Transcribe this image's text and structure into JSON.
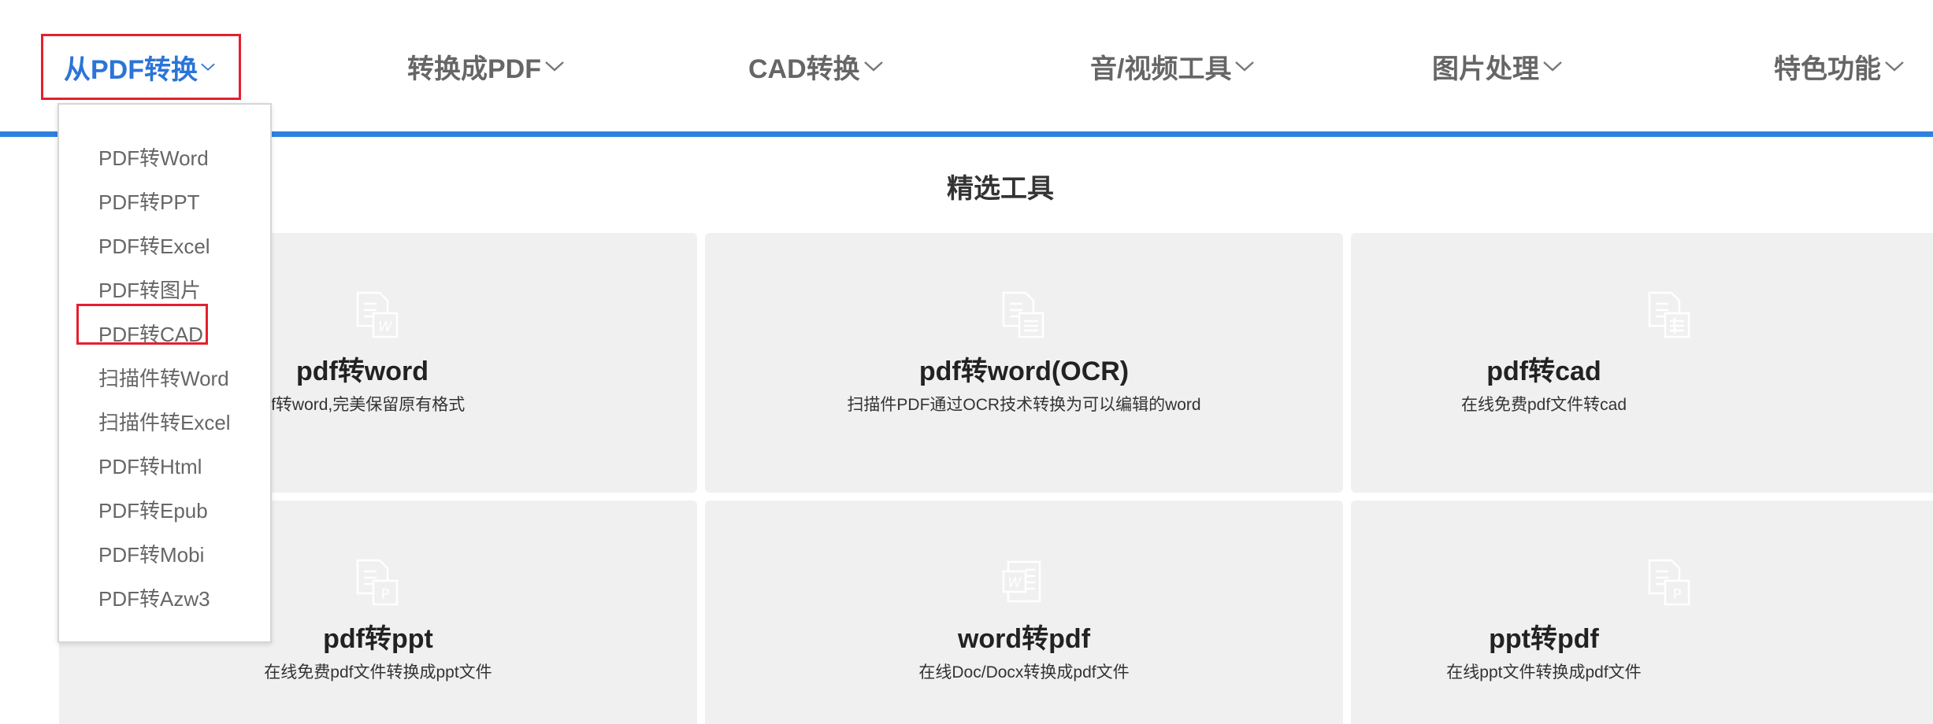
{
  "nav": {
    "items": [
      {
        "label": "从PDF转换",
        "active": true
      },
      {
        "label": "转换成PDF",
        "active": false
      },
      {
        "label": "CAD转换",
        "active": false
      },
      {
        "label": "音/视频工具",
        "active": false
      },
      {
        "label": "图片处理",
        "active": false
      },
      {
        "label": "特色功能",
        "active": false
      }
    ]
  },
  "section_title": "精选工具",
  "cards": [
    {
      "title": "pdf转word",
      "desc": "费pdf转word,完美保留原有格式",
      "icon": "pdf-to-word-icon"
    },
    {
      "title": "pdf转word(OCR)",
      "desc": "扫描件PDF通过OCR技术转换为可以编辑的word",
      "icon": "pdf-ocr-icon"
    },
    {
      "title": "pdf转cad",
      "desc": "在线免费pdf文件转cad",
      "icon": "pdf-to-cad-icon"
    },
    {
      "title": "pdf转ppt",
      "desc": "在线免费pdf文件转换成ppt文件",
      "icon": "pdf-to-ppt-icon"
    },
    {
      "title": "word转pdf",
      "desc": "在线Doc/Docx转换成pdf文件",
      "icon": "word-to-pdf-icon"
    },
    {
      "title": "ppt转pdf",
      "desc": "在线ppt文件转换成pdf文件",
      "icon": "ppt-to-pdf-icon"
    }
  ],
  "dropdown": {
    "items": [
      "PDF转Word",
      "PDF转PPT",
      "PDF转Excel",
      "PDF转图片",
      "PDF转CAD",
      "扫描件转Word",
      "扫描件转Excel",
      "PDF转Html",
      "PDF转Epub",
      "PDF转Mobi",
      "PDF转Azw3"
    ],
    "highlighted": "PDF转CAD"
  },
  "colors": {
    "accent": "#2f80e0",
    "active_text": "#2b74d8",
    "highlight_border": "#e5202e",
    "card_bg": "#f0f0f0"
  }
}
